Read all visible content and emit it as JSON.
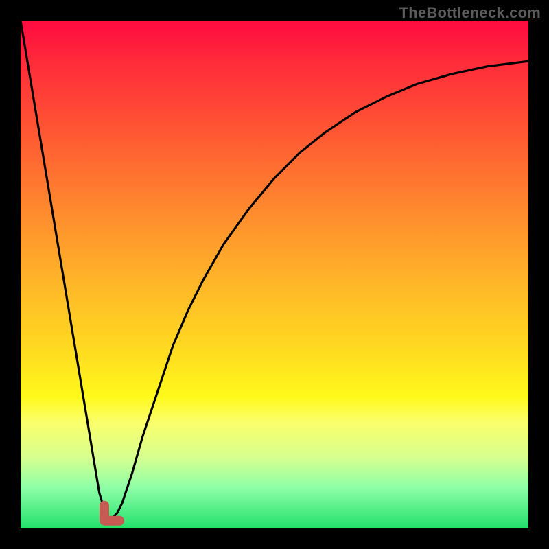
{
  "watermark": "TheBottleneck.com",
  "chart_data": {
    "type": "line",
    "title": "",
    "xlabel": "",
    "ylabel": "",
    "xlim": [
      0,
      100
    ],
    "ylim": [
      0,
      100
    ],
    "grid": false,
    "series": [
      {
        "name": "bottleneck-curve",
        "x": [
          0,
          2,
          4,
          6,
          8,
          10,
          12,
          14,
          15.5,
          17,
          18,
          19,
          20,
          22,
          24,
          26,
          28,
          30,
          33,
          36,
          40,
          45,
          50,
          55,
          60,
          66,
          72,
          78,
          85,
          92,
          100
        ],
        "y": [
          100,
          88,
          76,
          64,
          52,
          40,
          28,
          16,
          7,
          2,
          2,
          3,
          5,
          11,
          18,
          24,
          30,
          36,
          43,
          49,
          56,
          63,
          69,
          74,
          78,
          82,
          85,
          87.5,
          89.5,
          91,
          92
        ]
      }
    ],
    "annotations": [
      {
        "name": "min-marker",
        "shape": "L",
        "x": 17.3,
        "y": 1.8,
        "color": "#c85a54"
      }
    ],
    "background": {
      "type": "vertical-gradient",
      "stops": [
        {
          "pos": 0.0,
          "color": "#ff0a40"
        },
        {
          "pos": 0.38,
          "color": "#ff8c2e"
        },
        {
          "pos": 0.66,
          "color": "#ffde20"
        },
        {
          "pos": 0.86,
          "color": "#d7ff8f"
        },
        {
          "pos": 1.0,
          "color": "#22e06a"
        }
      ]
    }
  }
}
